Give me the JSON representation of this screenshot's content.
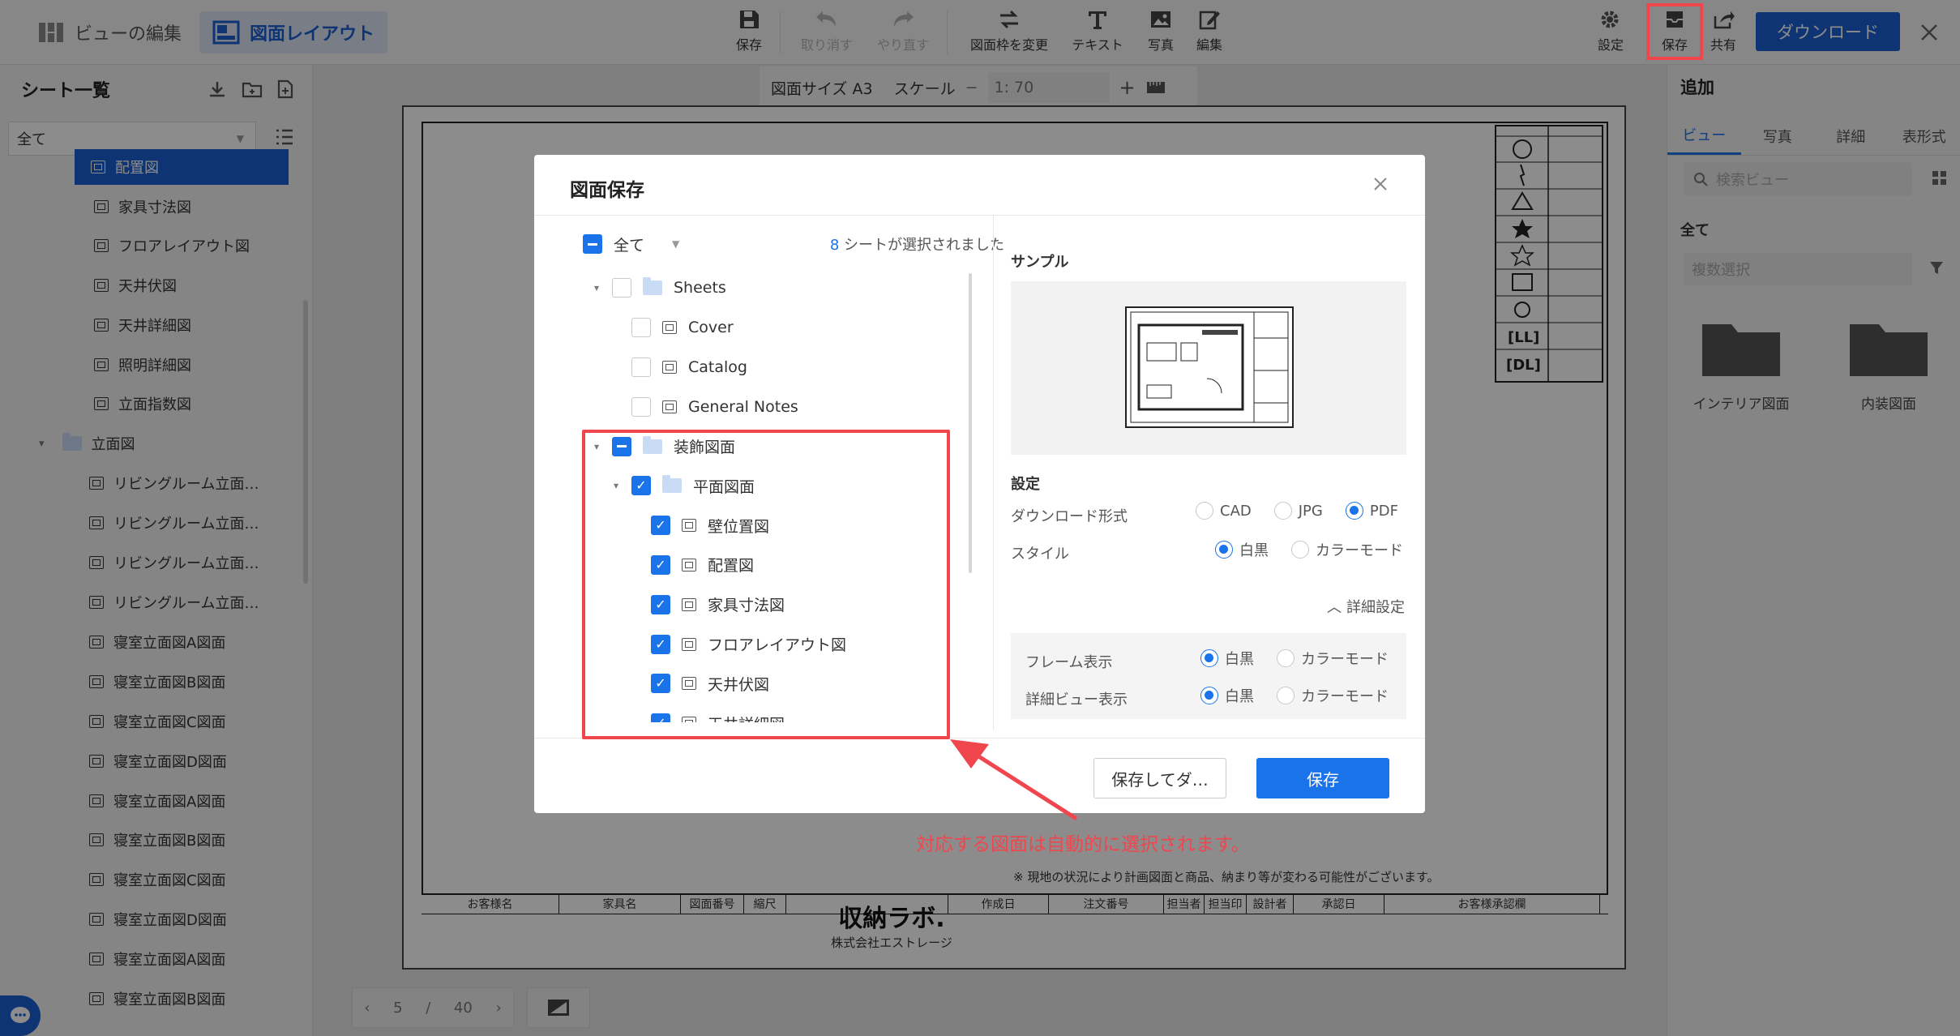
{
  "topbar": {
    "edit_view": "ビューの編集",
    "layout": "図面レイアウト",
    "tools": [
      {
        "icon": "save-icon",
        "label": "保存",
        "disabled": false
      },
      {
        "icon": "undo-icon",
        "label": "取り消す",
        "disabled": true
      },
      {
        "icon": "redo-icon",
        "label": "やり直す",
        "disabled": true
      },
      {
        "icon": "swap-icon",
        "label": "図面枠を変更",
        "disabled": false
      },
      {
        "icon": "text-icon",
        "label": "テキスト",
        "disabled": false
      },
      {
        "icon": "image-icon",
        "label": "写真",
        "disabled": false
      },
      {
        "icon": "edit-icon",
        "label": "編集",
        "disabled": false
      }
    ],
    "settings": "設定",
    "save": "保存",
    "share": "共有",
    "download": "ダウンロード"
  },
  "left_panel": {
    "title": "シート一覧",
    "filter_value": "全て",
    "items": [
      {
        "label": "配置図",
        "selected": true,
        "type": "sheet"
      },
      {
        "label": "家具寸法図",
        "type": "sheet"
      },
      {
        "label": "フロアレイアウト図",
        "type": "sheet"
      },
      {
        "label": "天井伏図",
        "type": "sheet"
      },
      {
        "label": "天井詳細図",
        "type": "sheet"
      },
      {
        "label": "照明詳細図",
        "type": "sheet"
      },
      {
        "label": "立面指数図",
        "type": "sheet"
      },
      {
        "label": "立面図",
        "type": "folder"
      },
      {
        "label": "リビングルーム立面…",
        "type": "sheet"
      },
      {
        "label": "リビングルーム立面…",
        "type": "sheet"
      },
      {
        "label": "リビングルーム立面…",
        "type": "sheet"
      },
      {
        "label": "リビングルーム立面…",
        "type": "sheet"
      },
      {
        "label": "寝室立面図A図面",
        "type": "sheet"
      },
      {
        "label": "寝室立面図B図面",
        "type": "sheet"
      },
      {
        "label": "寝室立面図C図面",
        "type": "sheet"
      },
      {
        "label": "寝室立面図D図面",
        "type": "sheet"
      },
      {
        "label": "寝室立面図A図面",
        "type": "sheet"
      },
      {
        "label": "寝室立面図B図面",
        "type": "sheet"
      },
      {
        "label": "寝室立面図C図面",
        "type": "sheet"
      },
      {
        "label": "寝室立面図D図面",
        "type": "sheet"
      },
      {
        "label": "寝室立面図A図面",
        "type": "sheet"
      },
      {
        "label": "寝室立面図B図面",
        "type": "sheet"
      }
    ]
  },
  "paper_toolbar": {
    "size": "図面サイズ A3",
    "scale_label": "スケール",
    "scale_value": "1: 70"
  },
  "pager": {
    "current": "5",
    "total": "40"
  },
  "title_block": {
    "headers": [
      "お客様名",
      "家具名",
      "図面番号",
      "縮尺",
      "",
      "作成日",
      "注文番号",
      "担当者",
      "担当印",
      "設計者",
      "承認日",
      "お客様承認欄"
    ],
    "brand": "収納ラボ.",
    "company": "株式会社エストレージ",
    "note": "※ 現地の状況により計画図面と商品、納まり等が変わる可能性がございます。"
  },
  "right_panel": {
    "title": "追加",
    "tabs": [
      "ビュー",
      "写真",
      "詳細",
      "表形式"
    ],
    "search_placeholder": "検索ビュー",
    "section": "全て",
    "multi_select": "複数選択",
    "folders": [
      "インテリア図面",
      "内装図面"
    ]
  },
  "dialog": {
    "title": "図面保存",
    "all_label": "全て",
    "selected_count": "8",
    "selected_suffix": "シートが選択されました",
    "tree": [
      {
        "label": "Sheets",
        "type": "folder",
        "state": "off",
        "level": 0,
        "caret": true
      },
      {
        "label": "Cover",
        "type": "sheet",
        "state": "off",
        "level": 1
      },
      {
        "label": "Catalog",
        "type": "sheet",
        "state": "off",
        "level": 1
      },
      {
        "label": "General Notes",
        "type": "sheet",
        "state": "off",
        "level": 1
      },
      {
        "label": "装飾図面",
        "type": "folder",
        "state": "mid",
        "level": 0,
        "caret": true
      },
      {
        "label": "平面図面",
        "type": "folder",
        "state": "on",
        "level": 1,
        "caret": true
      },
      {
        "label": "壁位置図",
        "type": "sheet",
        "state": "on",
        "level": 2
      },
      {
        "label": "配置図",
        "type": "sheet",
        "state": "on",
        "level": 2
      },
      {
        "label": "家具寸法図",
        "type": "sheet",
        "state": "on",
        "level": 2
      },
      {
        "label": "フロアレイアウト図",
        "type": "sheet",
        "state": "on",
        "level": 2
      },
      {
        "label": "天井伏図",
        "type": "sheet",
        "state": "on",
        "level": 2
      },
      {
        "label": "天井詳細図",
        "type": "sheet",
        "state": "on",
        "level": 2
      }
    ],
    "sample_label": "サンプル",
    "settings_label": "設定",
    "download_format_label": "ダウンロード形式",
    "formats": [
      {
        "label": "CAD",
        "on": false
      },
      {
        "label": "JPG",
        "on": false
      },
      {
        "label": "PDF",
        "on": true
      }
    ],
    "style_label": "スタイル",
    "styles": [
      {
        "label": "白黒",
        "on": true
      },
      {
        "label": "カラーモード",
        "on": false
      }
    ],
    "advanced_label": "詳細設定",
    "frame_label": "フレーム表示",
    "frame_opts": [
      {
        "label": "白黒",
        "on": true
      },
      {
        "label": "カラーモード",
        "on": false
      }
    ],
    "detail_label": "詳細ビュー表示",
    "detail_opts": [
      {
        "label": "白黒",
        "on": true
      },
      {
        "label": "カラーモード",
        "on": false
      }
    ],
    "save_download_btn": "保存してダ…",
    "save_btn": "保存"
  },
  "annotation": {
    "text": "対応する図面は自動的に選択されます。",
    "color": "#f0464e"
  },
  "colors": {
    "accent": "#1a73e8",
    "brand": "#1a5fd3",
    "highlight": "#f0464e"
  }
}
